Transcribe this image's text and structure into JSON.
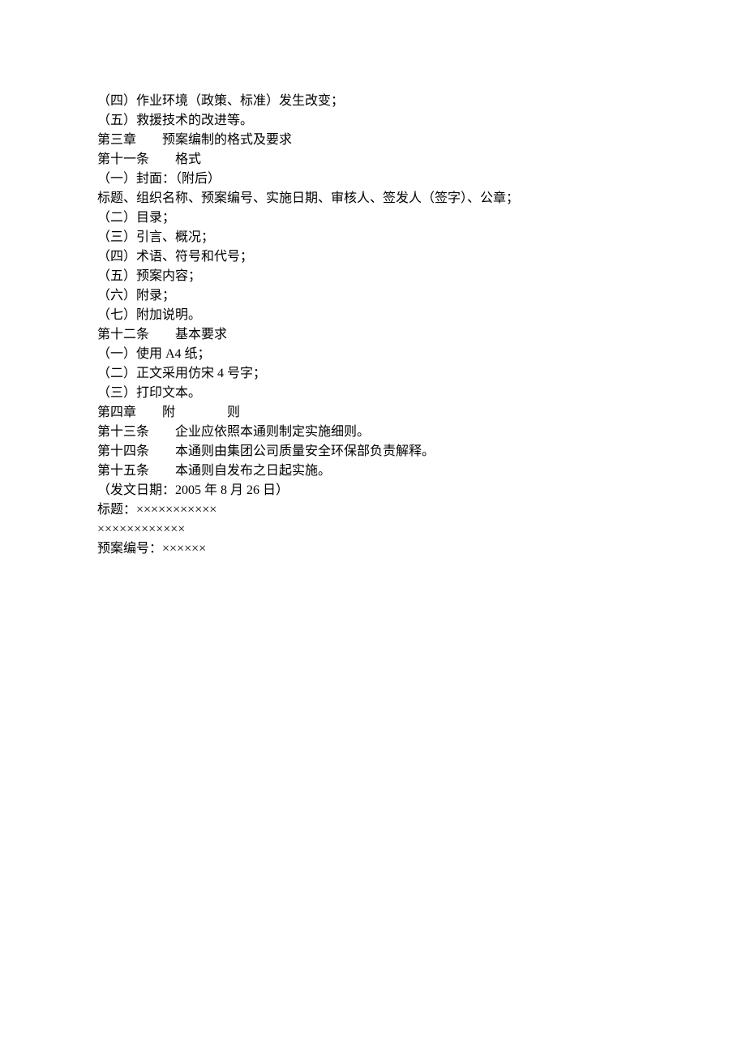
{
  "lines": [
    "（四）作业环境（政策、标准）发生改变；",
    "（五）救援技术的改进等。",
    "第三章　　预案编制的格式及要求",
    "第十一条　　格式",
    "（一）封面：（附后）",
    "标题、组织名称、预案编号、实施日期、审核人、签发人（签字）、公章；",
    "（二）目录；",
    "（三）引言、概况；",
    "（四）术语、符号和代号；",
    "（五）预案内容；",
    "（六）附录；",
    "（七）附加说明。",
    "第十二条　　基本要求",
    "（一）使用 A4 纸；",
    "（二）正文采用仿宋 4 号字；",
    "（三）打印文本。",
    "第四章　　附　　　　则",
    "第十三条　　企业应依照本通则制定实施细则。",
    "第十四条　　本通则由集团公司质量安全环保部负责解释。",
    "第十五条　　本通则自发布之日起实施。",
    "",
    "（发文日期：2005 年 8 月 26 日）",
    "",
    "",
    "标题：×××××××××××",
    "××××××××××××",
    "",
    "",
    "预案编号：××××××"
  ]
}
